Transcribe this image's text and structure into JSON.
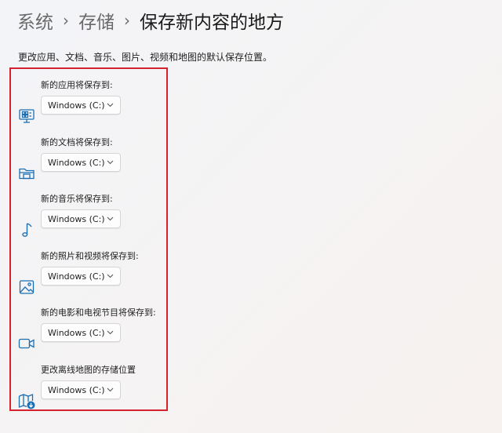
{
  "breadcrumb": {
    "items": [
      "系统",
      "存储",
      "保存新内容的地方"
    ],
    "separator": "›"
  },
  "description": "更改应用、文档、音乐、图片、视频和地图的默认保存位置。",
  "highlight_color": "#d4232f",
  "accent_color": "#1a6fb5",
  "settings": [
    {
      "label": "新的应用将保存到:",
      "icon": "apps-icon",
      "value": "Windows (C:)"
    },
    {
      "label": "新的文档将保存到:",
      "icon": "folder-icon",
      "value": "Windows (C:)"
    },
    {
      "label": "新的音乐将保存到:",
      "icon": "music-note-icon",
      "value": "Windows (C:)"
    },
    {
      "label": "新的照片和视频将保存到:",
      "icon": "picture-icon",
      "value": "Windows (C:)"
    },
    {
      "label": "新的电影和电视节目将保存到:",
      "icon": "video-camera-icon",
      "value": "Windows (C:)"
    },
    {
      "label": "更改离线地图的存储位置",
      "icon": "offline-map-icon",
      "value": "Windows (C:)"
    }
  ]
}
